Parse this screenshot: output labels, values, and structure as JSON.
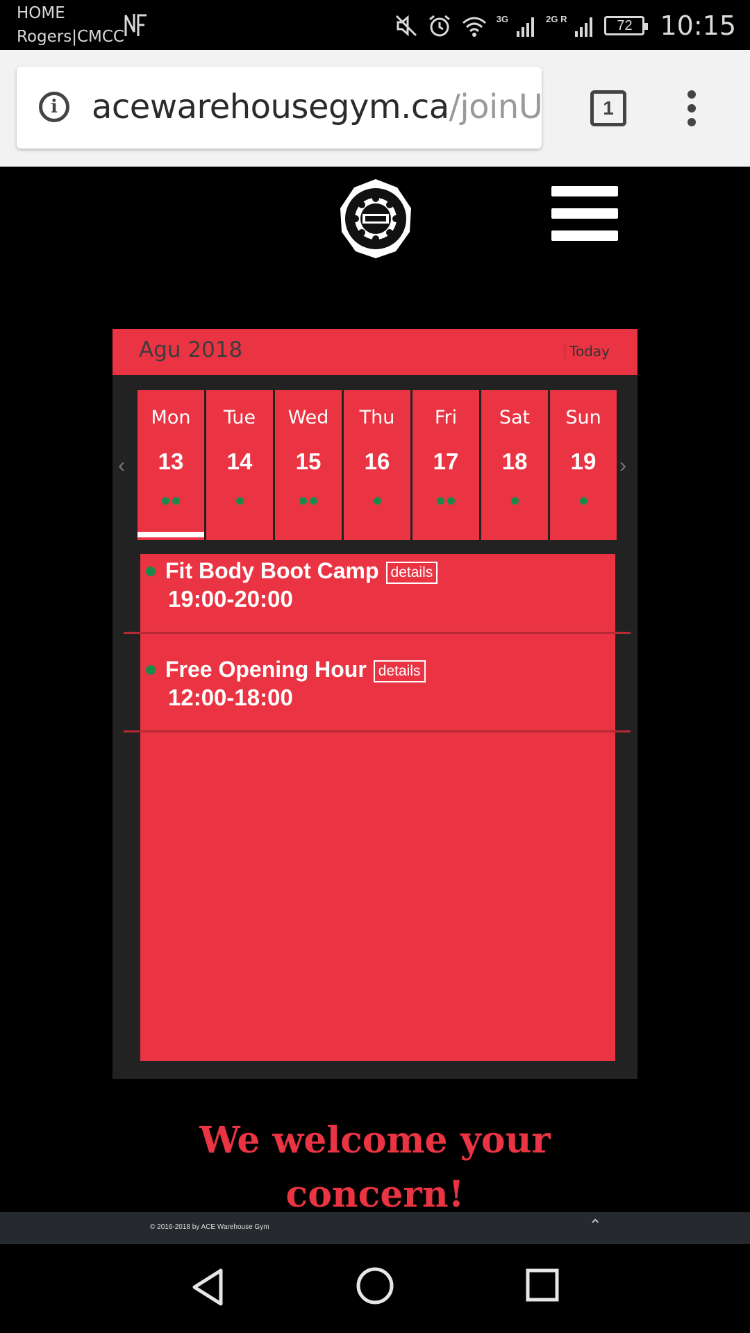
{
  "status_bar": {
    "carrier_line1": "HOME",
    "carrier_line2": "Rogers|CMCC",
    "network1": "3G",
    "network2": "2G R",
    "battery": "72",
    "time": "10:15",
    "icons": [
      "nfc-icon",
      "mute-icon",
      "alarm-icon",
      "wifi-icon",
      "signal-icon",
      "signal-icon",
      "battery-icon"
    ]
  },
  "browser": {
    "url_domain": "acewarehousegym.ca",
    "url_path": "/joinUs.",
    "tab_count": "1"
  },
  "calendar": {
    "month_label": "Agu 2018",
    "today_label": "Today",
    "prev_arrow": "‹",
    "next_arrow": "›",
    "days": [
      {
        "name": "Mon",
        "date": "13",
        "dots": 2,
        "selected": true
      },
      {
        "name": "Tue",
        "date": "14",
        "dots": 1
      },
      {
        "name": "Wed",
        "date": "15",
        "dots": 2
      },
      {
        "name": "Thu",
        "date": "16",
        "dots": 1
      },
      {
        "name": "Fri",
        "date": "17",
        "dots": 2
      },
      {
        "name": "Sat",
        "date": "18",
        "dots": 1
      },
      {
        "name": "Sun",
        "date": "19",
        "dots": 1
      }
    ],
    "events": [
      {
        "title": "Fit Body Boot Camp",
        "details_label": "details",
        "time": "19:00-20:00"
      },
      {
        "title": "Free Opening Hour",
        "details_label": "details",
        "time": "12:00-18:00"
      }
    ]
  },
  "welcome": {
    "line1": "We welcome your",
    "line2": "concern!"
  },
  "footer": {
    "copyright": "© 2016-2018 by ACE Warehouse Gym",
    "back_to_top": "⌃"
  },
  "colors": {
    "brand_red": "#ea3443",
    "event_dot_green": "#1a8a4a",
    "calendar_bg": "#222222",
    "page_bg": "#000000"
  }
}
